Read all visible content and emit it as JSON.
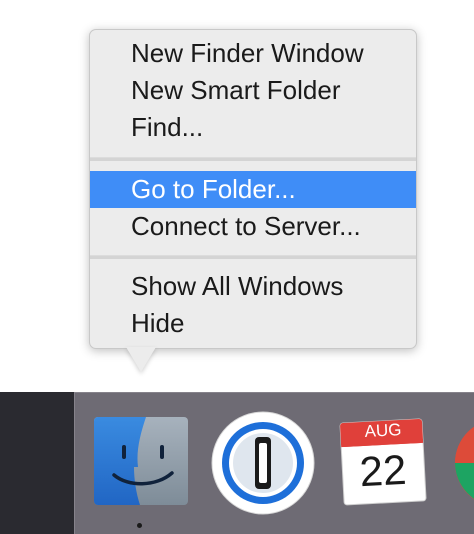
{
  "context_menu": {
    "items": [
      {
        "label": "New Finder Window"
      },
      {
        "label": "New Smart Folder"
      },
      {
        "label": "Find..."
      },
      {
        "label": "Go to Folder...",
        "selected": true
      },
      {
        "label": "Connect to Server..."
      },
      {
        "label": "Show All Windows"
      },
      {
        "label": "Hide"
      }
    ]
  },
  "dock": {
    "apps": [
      {
        "name": "Finder",
        "icon": "finder-icon"
      },
      {
        "name": "1Password",
        "icon": "1password-icon"
      },
      {
        "name": "Calendar",
        "icon": "calendar-icon",
        "month": "AUG",
        "day": "22"
      },
      {
        "name": "Chrome",
        "icon": "chrome-icon"
      }
    ]
  },
  "colors": {
    "menu_bg": "#ececec",
    "selection": "#3f8df7",
    "dock_bg": "#6e6b74",
    "calendar_red": "#e0403a"
  }
}
